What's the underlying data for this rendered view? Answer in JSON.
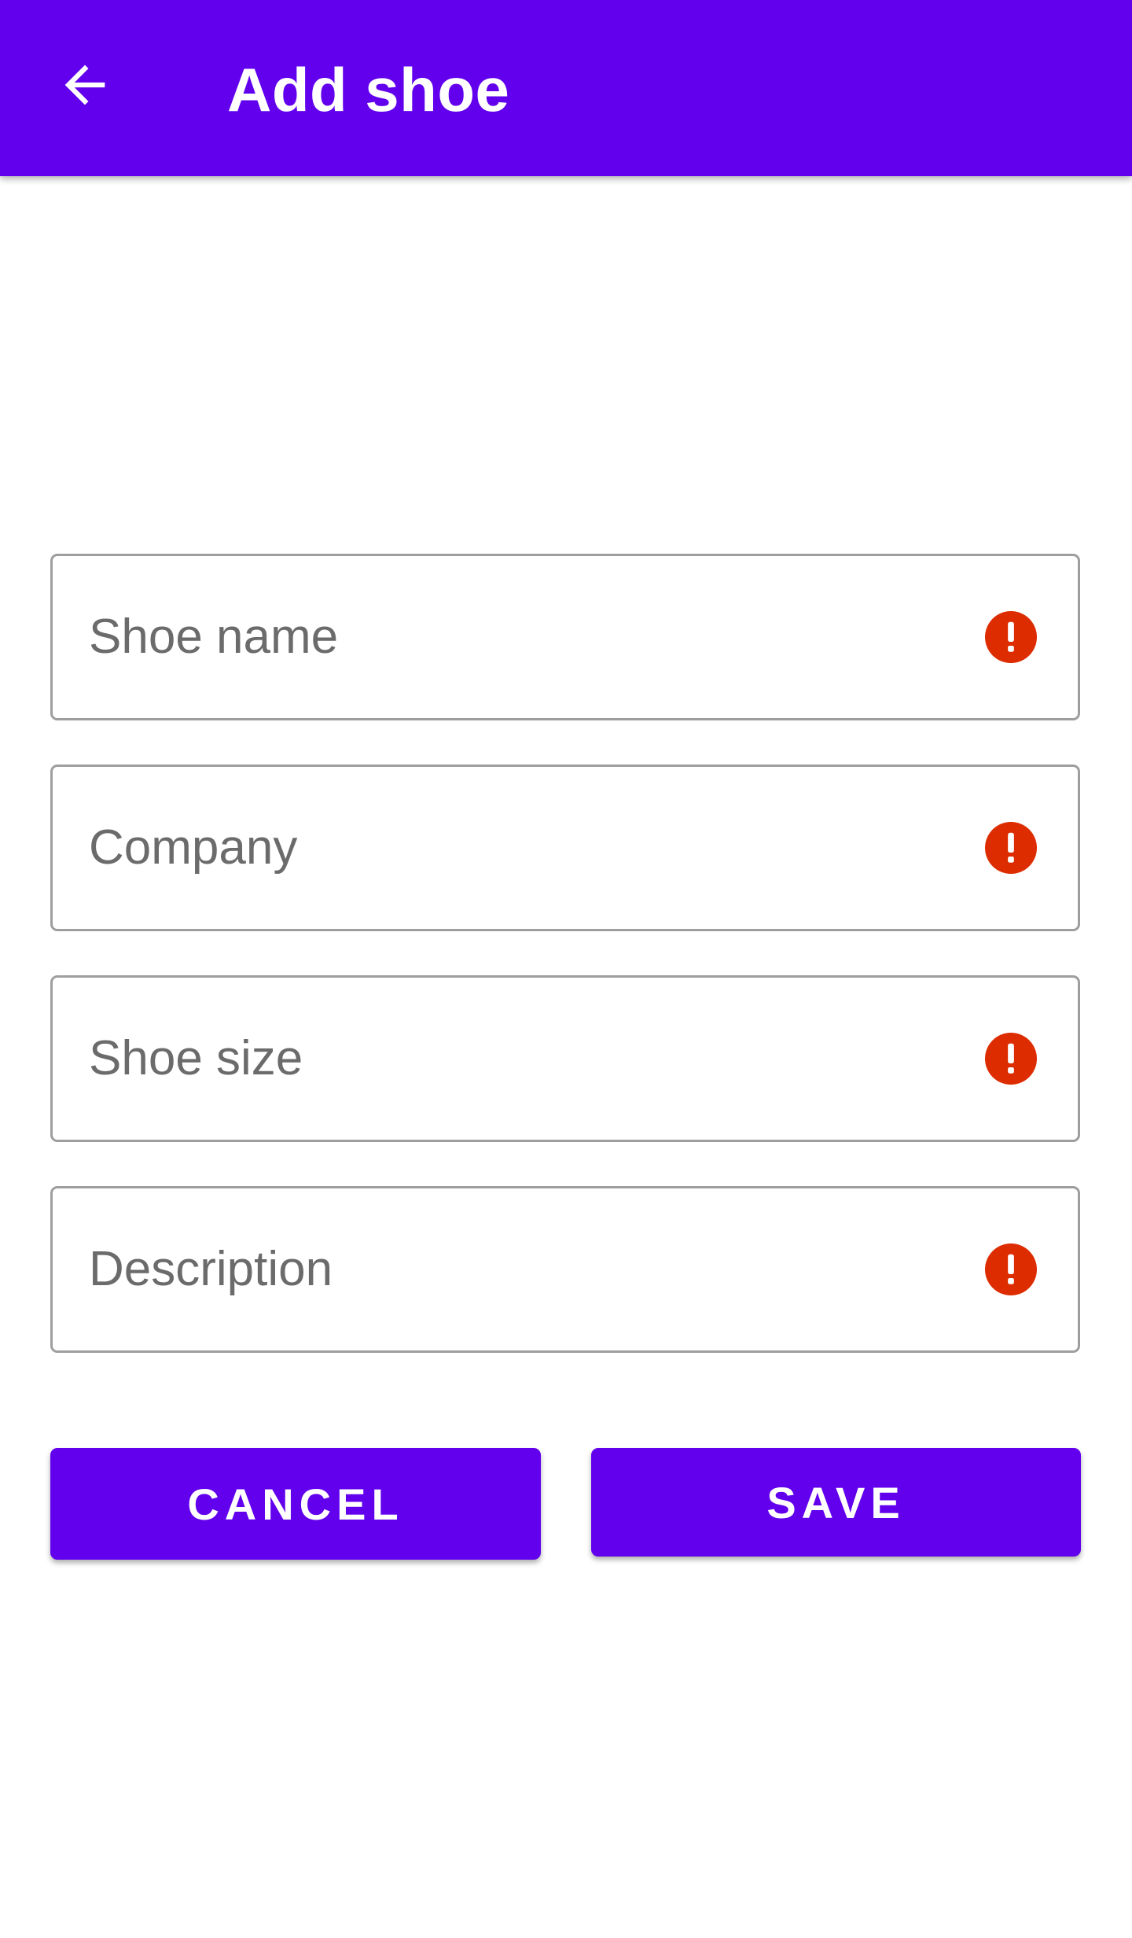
{
  "app_bar": {
    "title": "Add shoe",
    "back_icon": "arrow-back-icon",
    "background_color": "#6200EE"
  },
  "form": {
    "fields": [
      {
        "placeholder": "Shoe name",
        "value": "",
        "error_icon": "error-icon"
      },
      {
        "placeholder": "Company",
        "value": "",
        "error_icon": "error-icon"
      },
      {
        "placeholder": "Shoe size",
        "value": "",
        "error_icon": "error-icon"
      },
      {
        "placeholder": "Description",
        "value": "",
        "error_icon": "error-icon"
      }
    ],
    "error_color": "#DD2C00"
  },
  "actions": {
    "cancel_label": "CANCEL",
    "save_label": "SAVE"
  }
}
